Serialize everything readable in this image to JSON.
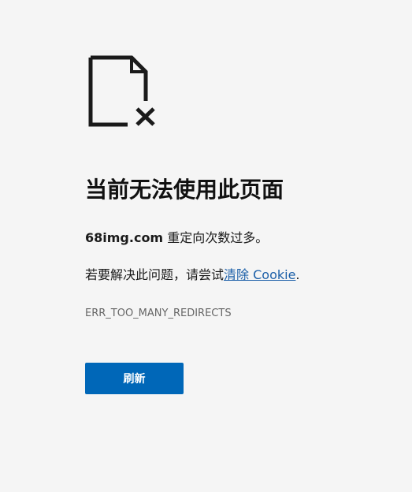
{
  "error": {
    "title": "当前无法使用此页面",
    "host": "68img.com",
    "host_message": " 重定向次数过多。",
    "suggestion_prefix": "若要解决此问题，请尝试",
    "suggestion_link": "清除 Cookie",
    "suggestion_suffix": ".",
    "code": "ERR_TOO_MANY_REDIRECTS",
    "refresh_label": "刷新",
    "icon": "broken-document-icon"
  },
  "colors": {
    "background": "#f5f5f5",
    "button": "#0067b8",
    "link": "#1b5fa8",
    "code_text": "#666666"
  }
}
